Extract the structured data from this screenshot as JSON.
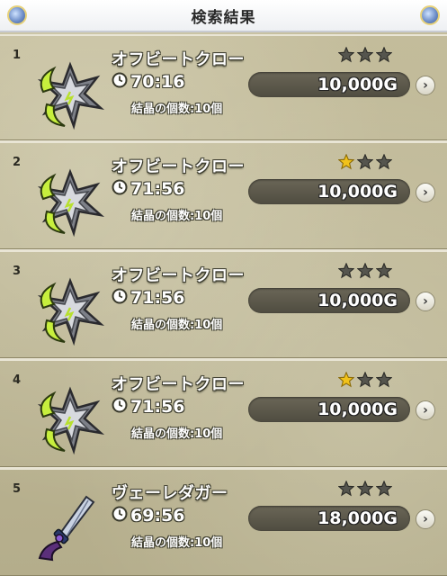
{
  "header": {
    "title": "検索結果"
  },
  "colors": {
    "star_on": "#f1c21a",
    "star_off": "#55554e",
    "price_bg": "#55523f"
  },
  "items": [
    {
      "index": "1",
      "name": "オフビートクロー",
      "time": "70:16",
      "crystals": "結晶の個数:10個",
      "price": "10,000G",
      "stars": 0,
      "icon": "claw-icon"
    },
    {
      "index": "2",
      "name": "オフビートクロー",
      "time": "71:56",
      "crystals": "結晶の個数:10個",
      "price": "10,000G",
      "stars": 1,
      "icon": "claw-icon"
    },
    {
      "index": "3",
      "name": "オフビートクロー",
      "time": "71:56",
      "crystals": "結晶の個数:10個",
      "price": "10,000G",
      "stars": 0,
      "icon": "claw-icon"
    },
    {
      "index": "4",
      "name": "オフビートクロー",
      "time": "71:56",
      "crystals": "結晶の個数:10個",
      "price": "10,000G",
      "stars": 1,
      "icon": "claw-icon"
    },
    {
      "index": "5",
      "name": "ヴェーレダガー",
      "time": "69:56",
      "crystals": "結晶の個数:10個",
      "price": "18,000G",
      "stars": 0,
      "icon": "dagger-icon"
    }
  ],
  "arrow_glyph": "›"
}
